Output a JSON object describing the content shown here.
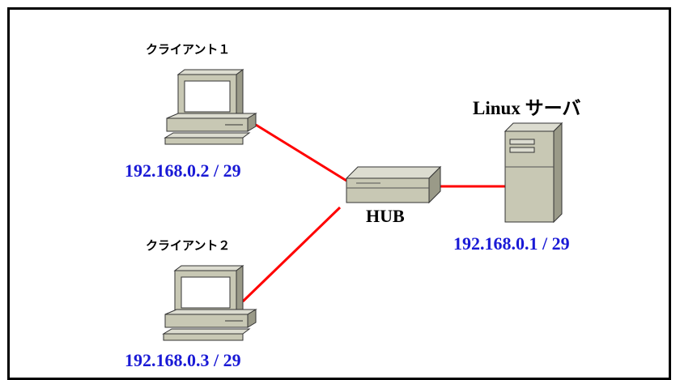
{
  "client1": {
    "label": "クライアント１",
    "ip": "192.168.0.2 / 29"
  },
  "client2": {
    "label": "クライアント２",
    "ip": "192.168.0.3 / 29"
  },
  "hub": {
    "label": "HUB"
  },
  "server": {
    "label": "Linux サーバ",
    "ip": "192.168.0.1 / 29"
  },
  "colors": {
    "link": "#ff0000",
    "ip_text": "#1a1ad6",
    "device_body": "#c8c8b4"
  },
  "icons": {
    "client": "desktop-computer-icon",
    "hub": "network-hub-icon",
    "server": "tower-server-icon"
  }
}
